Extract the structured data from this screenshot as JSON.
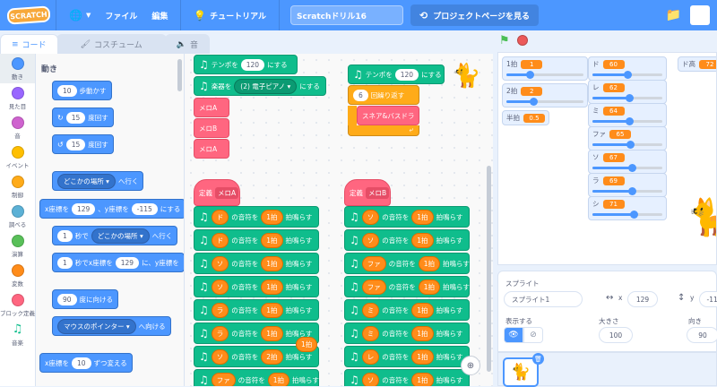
{
  "topbar": {
    "logo": "SCRATCH",
    "file": "ファイル",
    "edit": "編集",
    "tutorial": "チュートリアル",
    "project_title": "Scratchドリル16",
    "project_page": "プロジェクトページを見る"
  },
  "tabs": {
    "code": "コード",
    "costume": "コスチューム",
    "sound": "音"
  },
  "categories": [
    {
      "label": "動き",
      "color": "#4c97ff"
    },
    {
      "label": "見た目",
      "color": "#9966ff"
    },
    {
      "label": "音",
      "color": "#cf63cf"
    },
    {
      "label": "イベント",
      "color": "#ffbf00"
    },
    {
      "label": "制御",
      "color": "#ffab19"
    },
    {
      "label": "調べる",
      "color": "#5cb1d6"
    },
    {
      "label": "演算",
      "color": "#59c059"
    },
    {
      "label": "変数",
      "color": "#ff8c1a"
    },
    {
      "label": "ブロック定義",
      "color": "#ff6680"
    },
    {
      "label": "音楽",
      "color": "#0fbd8c"
    }
  ],
  "palette": {
    "heading": "動き",
    "move": {
      "val": "10",
      "txt": "歩動かす"
    },
    "turn_r": {
      "val": "15",
      "txt": "度回す"
    },
    "turn_l": {
      "val": "15",
      "txt": "度回す"
    },
    "goto": {
      "dd": "どこかの場所",
      "txt": "へ行く"
    },
    "gotoxy": {
      "a": "x座標を",
      "x": "129",
      "b": "、y座標を",
      "y": "-115",
      "c": "にする"
    },
    "glide": {
      "sec": "1",
      "a": "秒で",
      "dd": "どこかの場所",
      "b": "へ行く"
    },
    "glidexy": {
      "sec": "1",
      "a": "秒でx座標を",
      "x": "129",
      "b": "に、y座標を"
    },
    "point": {
      "val": "90",
      "txt": "度に向ける"
    },
    "towards": {
      "dd": "マウスのポインター",
      "txt": "へ向ける"
    },
    "changex": {
      "a": "x座標を",
      "val": "10",
      "b": "ずつ変える"
    }
  },
  "workspace": {
    "tempo_label": "テンポを",
    "tempo_val": "120",
    "tempo_end": "にする",
    "instr_label": "楽器を",
    "instr_val": "(2) 電子ピアノ",
    "instr_end": "にする",
    "melA": "メロA",
    "melB": "メロB",
    "melA2": "メロA",
    "repeat_val": "6",
    "repeat_txt": "回繰り返す",
    "snare": "スネア&バスドラ",
    "def": "定義",
    "defA": "メロA",
    "defB": "メロB",
    "note_mid": "の音符を",
    "beat_end": "拍鳴らす",
    "beat_marker": "1拍",
    "left_notes": [
      {
        "n": "ド",
        "b": "1拍"
      },
      {
        "n": "ド",
        "b": "1拍"
      },
      {
        "n": "ソ",
        "b": "1拍"
      },
      {
        "n": "ソ",
        "b": "1拍"
      },
      {
        "n": "ラ",
        "b": "1拍"
      },
      {
        "n": "ラ",
        "b": "1拍"
      },
      {
        "n": "ソ",
        "b": "2拍"
      },
      {
        "n": "ファ",
        "b": "1拍"
      }
    ],
    "right_notes": [
      {
        "n": "ソ",
        "b": "1拍"
      },
      {
        "n": "ソ",
        "b": "1拍"
      },
      {
        "n": "ファ",
        "b": "1拍"
      },
      {
        "n": "ファ",
        "b": "1拍"
      },
      {
        "n": "ミ",
        "b": "1拍"
      },
      {
        "n": "ミ",
        "b": "1拍"
      },
      {
        "n": "レ",
        "b": "1拍"
      },
      {
        "n": "ソ",
        "b": "1拍"
      }
    ]
  },
  "monitors": {
    "one_beat": {
      "label": "1拍",
      "value": "1",
      "level": 0.3
    },
    "two_beat": {
      "label": "2拍",
      "value": "2",
      "level": 0.35
    },
    "half_beat": {
      "label": "半拍",
      "value": "0.5"
    },
    "notes": [
      {
        "label": "ド",
        "value": "60",
        "level": 0.5
      },
      {
        "label": "レ",
        "value": "62",
        "level": 0.52
      },
      {
        "label": "ミ",
        "value": "64",
        "level": 0.53
      },
      {
        "label": "ファ",
        "value": "65",
        "level": 0.54
      },
      {
        "label": "ソ",
        "value": "67",
        "level": 0.56
      },
      {
        "label": "ラ",
        "value": "69",
        "level": 0.57
      },
      {
        "label": "シ",
        "value": "71",
        "level": 0.59
      }
    ],
    "high_do": {
      "label": "ド高",
      "value": "72"
    }
  },
  "sprite": {
    "title": "スプライト",
    "name": "スプライト1",
    "x_label": "x",
    "x": "129",
    "y_label": "y",
    "y": "-115",
    "show_label": "表示する",
    "size_label": "大きさ",
    "size": "100",
    "dir_label": "向き",
    "dir": "90"
  },
  "colors": {
    "motion": "#4c97ff",
    "music": "#0fbd8c",
    "myblocks": "#ff6680",
    "control": "#ffab19",
    "variable": "#ff8c1a"
  }
}
